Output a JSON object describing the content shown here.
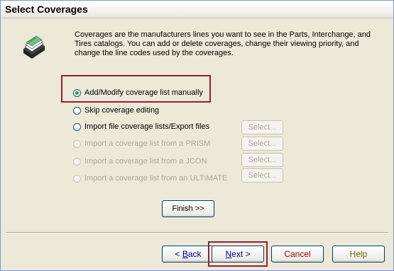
{
  "window": {
    "title": "Select Coverages"
  },
  "intro_text": "Coverages are the manufacturers lines you want to see in the Parts, Interchange, and Tires catalogs.  You can add or delete coverages, change their viewing priority, and change the line codes used by the coverages.",
  "options": [
    {
      "label": "Add/Modify coverage list manually",
      "checked": true,
      "enabled": true
    },
    {
      "label": "Skip coverage editing",
      "checked": false,
      "enabled": true
    },
    {
      "label": "Import file coverage lists/Export files",
      "checked": false,
      "enabled": true,
      "button": "Select..."
    },
    {
      "label": "Import a coverage list from a PRISM",
      "checked": false,
      "enabled": false,
      "button": "Select..."
    },
    {
      "label": "Import a coverage list from a  JCON",
      "checked": false,
      "enabled": false,
      "button": "Select..."
    },
    {
      "label": "Import a coverage list from an ULTIMATE",
      "checked": false,
      "enabled": false,
      "button": "Select..."
    }
  ],
  "finish_label": "Finish >>",
  "nav": {
    "back_prefix": "< ",
    "back_hotkey": "B",
    "back_rest": "ack",
    "next_hotkey": "N",
    "next_rest": "ext >",
    "cancel": "Cancel",
    "help": "Help"
  },
  "colors": {
    "highlight": "#9b1e2c",
    "cancel_text": "#a00000",
    "help_text": "#6b6b00",
    "nav_text": "#00008b"
  }
}
